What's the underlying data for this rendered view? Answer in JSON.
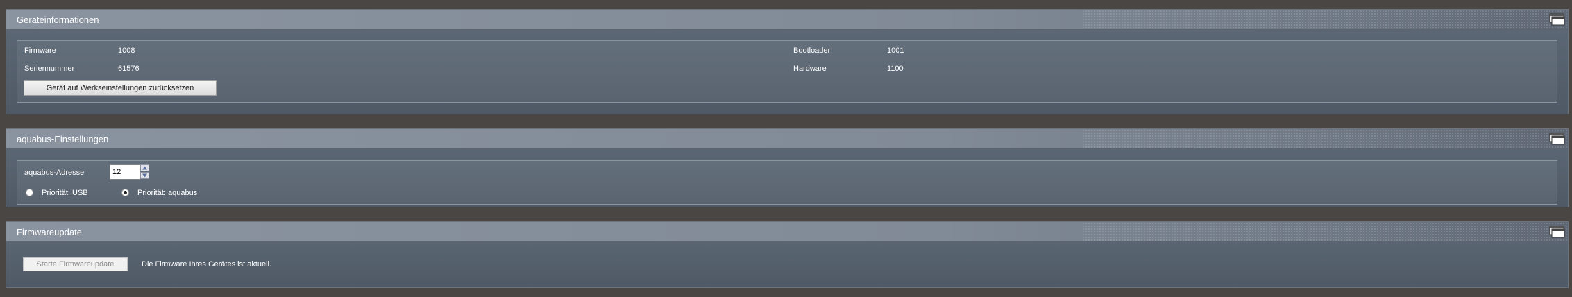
{
  "device_info": {
    "title": "Geräteinformationen",
    "firmware_label": "Firmware",
    "firmware_value": "1008",
    "serial_label": "Seriennummer",
    "serial_value": "61576",
    "bootloader_label": "Bootloader",
    "bootloader_value": "1001",
    "hardware_label": "Hardware",
    "hardware_value": "1100",
    "reset_button": "Gerät auf Werkseinstellungen zurücksetzen"
  },
  "aquabus": {
    "title": "aquabus-Einstellungen",
    "address_label": "aquabus-Adresse",
    "address_value": "12",
    "priority_usb": "Priorität: USB",
    "priority_aquabus": "Priorität: aquabus",
    "selected_priority": "aquabus"
  },
  "firmware_update": {
    "title": "Firmwareupdate",
    "start_button": "Starte Firmwareupdate",
    "status_text": "Die Firmware Ihres Gerätes ist aktuell."
  },
  "icons": {
    "panel_window": "window-stack-icon",
    "spinner_up": "arrow-up-icon",
    "spinner_down": "arrow-down-icon"
  },
  "colors": {
    "background": "#4a4644",
    "panel": "#5a6470",
    "header": "#8a93a0"
  }
}
